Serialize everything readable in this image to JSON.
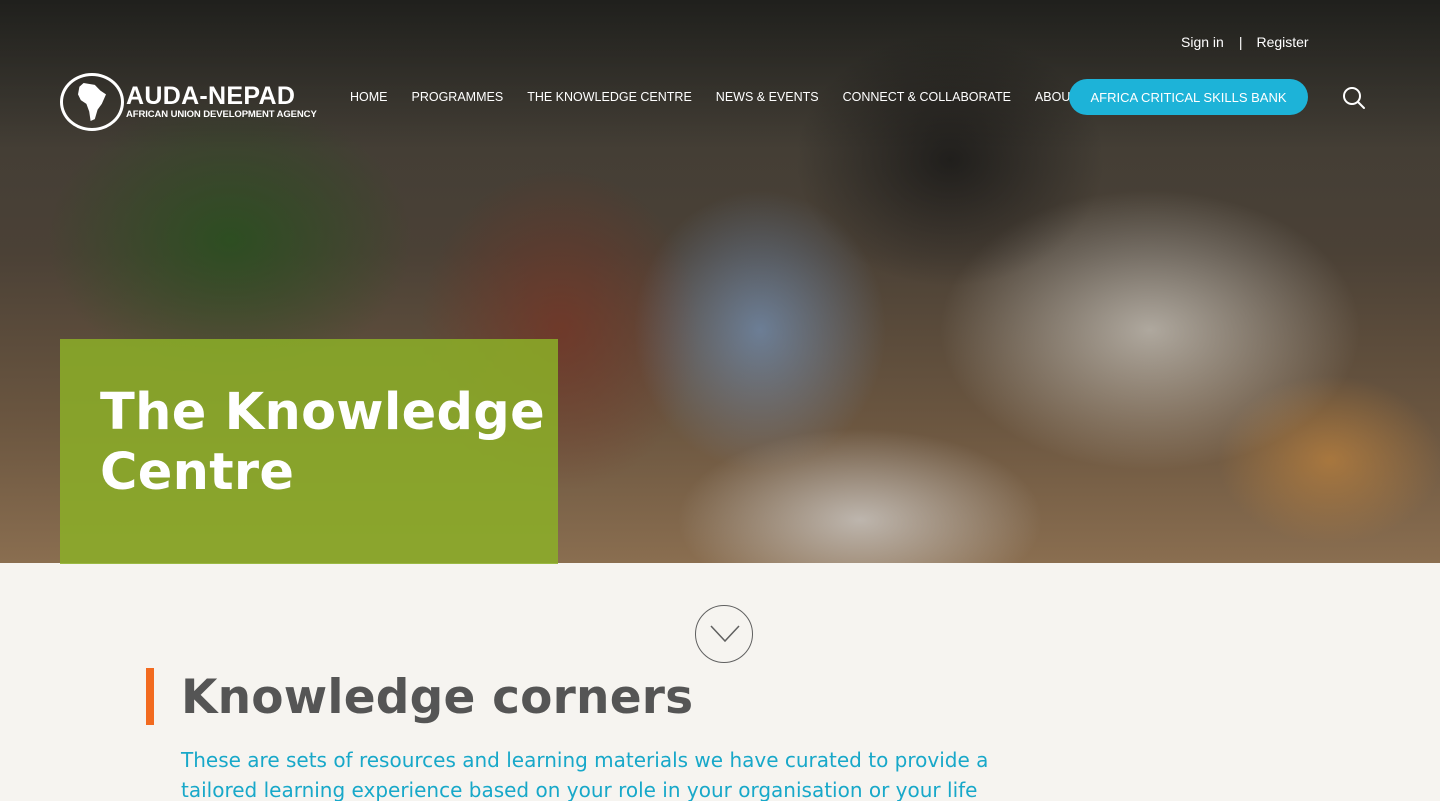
{
  "header": {
    "sign_in": "Sign in",
    "separator": "|",
    "register": "Register"
  },
  "logo": {
    "title": "AUDA-NEPAD",
    "subtitle": "AFRICAN UNION DEVELOPMENT AGENCY"
  },
  "nav": {
    "items": [
      {
        "label": "HOME"
      },
      {
        "label": "PROGRAMMES"
      },
      {
        "label": "THE KNOWLEDGE CENTRE"
      },
      {
        "label": "NEWS & EVENTS"
      },
      {
        "label": "CONNECT & COLLABORATE"
      },
      {
        "label": "ABOUT"
      }
    ],
    "cta_label": "AFRICA CRITICAL SKILLS BANK",
    "search_icon": "search-icon"
  },
  "hero": {
    "title": "The Knowledge Centre"
  },
  "colors": {
    "accent_cyan": "#1db3d8",
    "title_box_green": "#8caf28",
    "accent_orange": "#f26a1f",
    "text_cyan": "#18a8c9"
  },
  "section": {
    "title": "Knowledge corners",
    "description": "These are sets of resources and learning materials we have curated to provide a tailored learning experience based on your role in your organisation or your life situation.",
    "scroll_icon": "chevron-down-circle-icon"
  }
}
